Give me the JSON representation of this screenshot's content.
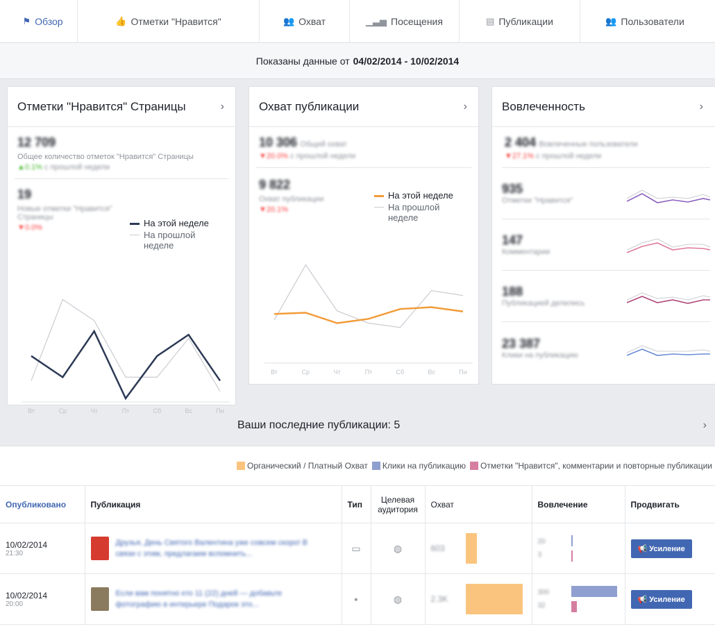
{
  "tabs": [
    {
      "label": "Обзор",
      "icon": "flag-icon",
      "active": true
    },
    {
      "label": "Отметки \"Нравится\"",
      "icon": "thumbs-up-icon",
      "active": false
    },
    {
      "label": "Охват",
      "icon": "people-icon",
      "active": false
    },
    {
      "label": "Посещения",
      "icon": "bar-chart-icon",
      "active": false
    },
    {
      "label": "Публикации",
      "icon": "posts-icon",
      "active": false
    },
    {
      "label": "Пользователи",
      "icon": "users-icon",
      "active": false
    }
  ],
  "daterange": {
    "prefix": "Показаны данные от",
    "range": "04/02/2014 - 10/02/2014"
  },
  "likes_card": {
    "title": "Отметки \"Нравится\" Страницы",
    "total_value": "12 709",
    "total_label": "Общее количество отметок \"Нравится\" Страницы",
    "total_change": "▲0.1%",
    "total_change_suffix": "с прошлой недели",
    "new_value": "19",
    "new_label": "Новые отметки \"Нравится\" Страницы",
    "new_change": "▼0.0%",
    "legend_this": "На этой неделе",
    "legend_prev": "На прошлой неделе"
  },
  "reach_card": {
    "title": "Охват публикации",
    "total_value": "10 306",
    "total_label": "Общий охват",
    "total_change": "▼20.0%",
    "total_change_suffix": "с прошлой недели",
    "post_value": "9 822",
    "post_label": "Охват публикации",
    "post_change": "▼20.1%",
    "legend_this": "На этой неделе",
    "legend_prev": "На прошлой неделе"
  },
  "engagement_card": {
    "title": "Вовлеченность",
    "total_value": "2 404",
    "total_label": "Вовлеченные пользователи",
    "total_change": "▼27.1%",
    "total_change_suffix": "с прошлой недели",
    "rows": [
      {
        "value": "935",
        "label": "Отметки \"Нравится\"",
        "color": "#8b5fbf"
      },
      {
        "value": "147",
        "label": "Комментарии",
        "color": "#e07b9a"
      },
      {
        "value": "188",
        "label": "Публикацией делились",
        "color": "#b0477a"
      },
      {
        "value": "23 387",
        "label": "Клики на публикацию",
        "color": "#6a8bd6"
      }
    ]
  },
  "recent": {
    "title": "Ваши последние публикации: 5"
  },
  "table_legend": [
    {
      "label": "Органический / Платный Охват",
      "color": "#fbc47e"
    },
    {
      "label": "Клики на публикацию",
      "color": "#8f9fd0"
    },
    {
      "label": "Отметки \"Нравится\", комментарии и повторные публикации",
      "color": "#d57ea0"
    }
  ],
  "table": {
    "headers": [
      "Опубликовано",
      "Публикация",
      "Тип",
      "Целевая аудитория",
      "Охват",
      "Вовлечение",
      "Продвигать"
    ],
    "rows": [
      {
        "date": "10/02/2014",
        "time": "21:30",
        "text": "Друзья, День Святого Валентина уже совсем скоро! В связи с этим, предлагаем вспомнить...",
        "thumb_color": "#d63b2f",
        "reach": "603",
        "reach_bar": 0.2,
        "eng_a": "20",
        "eng_b": "3",
        "clicks_bar": 0.0,
        "likes_bar": 0.0,
        "boost": "Усиление"
      },
      {
        "date": "10/02/2014",
        "time": "20:00",
        "text": "Если вам понятно кто 11 (22) дней — добавьте фотографию в интерьере Подарок это...",
        "thumb_color": "#8a7b5e",
        "reach": "2.3K",
        "reach_bar": 1.0,
        "eng_a": "300",
        "eng_b": "32",
        "clicks_bar": 1.0,
        "likes_bar": 0.12,
        "boost": "Усиление"
      }
    ]
  },
  "chart_data": [
    {
      "type": "line",
      "categories": [
        "Вт",
        "Ср",
        "Чт",
        "Пт",
        "Сб",
        "Вс",
        "Пн"
      ],
      "series": [
        {
          "name": "На этой неделе",
          "values": [
            20,
            8,
            34,
            -4,
            20,
            32,
            6
          ],
          "color": "#2c3a55"
        },
        {
          "name": "На прошлой неделе",
          "values": [
            6,
            52,
            40,
            8,
            8,
            30,
            0
          ],
          "color": "#c9ccd1"
        }
      ],
      "ylim": [
        -6,
        60
      ]
    },
    {
      "type": "line",
      "categories": [
        "Вт",
        "Ср",
        "Чт",
        "Пт",
        "Сб",
        "Вс",
        "Пн"
      ],
      "series": [
        {
          "name": "На этой неделе",
          "values": [
            1400,
            1420,
            1250,
            1320,
            1480,
            1510,
            1440
          ],
          "color": "#f29b38"
        },
        {
          "name": "На прошлой неделе",
          "values": [
            1300,
            2200,
            1450,
            1250,
            1180,
            1780,
            1700
          ],
          "color": "#c9ccd1"
        }
      ],
      "ylim": [
        600,
        2500
      ]
    }
  ]
}
